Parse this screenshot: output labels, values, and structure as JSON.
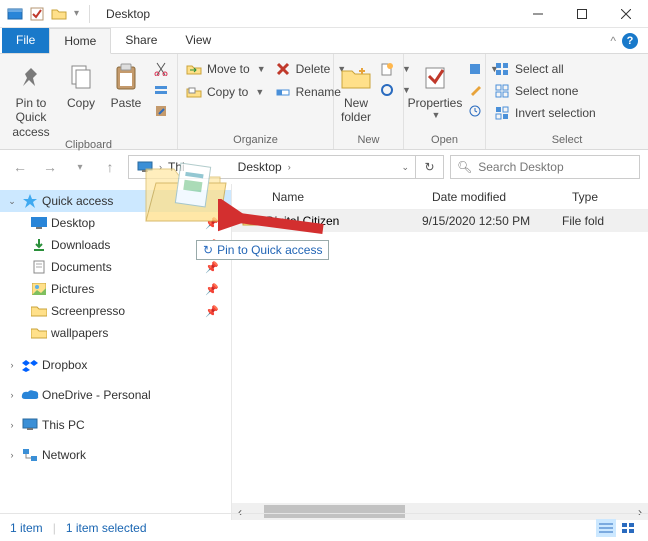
{
  "window": {
    "title": "Desktop"
  },
  "ribbon": {
    "tabs": {
      "file": "File",
      "home": "Home",
      "share": "Share",
      "view": "View"
    },
    "pin_to_quick": "Pin to Quick access",
    "copy": "Copy",
    "paste": "Paste",
    "group_clipboard": "Clipboard",
    "move_to": "Move to",
    "copy_to": "Copy to",
    "delete": "Delete",
    "rename": "Rename",
    "group_organize": "Organize",
    "new_folder": "New folder",
    "group_new": "New",
    "properties": "Properties",
    "group_open": "Open",
    "select_all": "Select all",
    "select_none": "Select none",
    "invert_selection": "Invert selection",
    "group_select": "Select"
  },
  "breadcrumb": {
    "root": "Thi",
    "part2": "Desktop"
  },
  "search": {
    "placeholder": "Search Desktop"
  },
  "nav": {
    "quick_access": "Quick access",
    "desktop": "Desktop",
    "downloads": "Downloads",
    "documents": "Documents",
    "pictures": "Pictures",
    "screenpresso": "Screenpresso",
    "wallpapers": "wallpapers",
    "dropbox": "Dropbox",
    "onedrive": "OneDrive - Personal",
    "this_pc": "This PC",
    "network": "Network"
  },
  "columns": {
    "name": "Name",
    "date": "Date modified",
    "type": "Type"
  },
  "rows": [
    {
      "name": "Digital Citizen",
      "date": "9/15/2020 12:50 PM",
      "type": "File fold"
    }
  ],
  "drag_hint": "Pin to Quick access",
  "status": {
    "items": "1 item",
    "selected": "1 item selected"
  }
}
